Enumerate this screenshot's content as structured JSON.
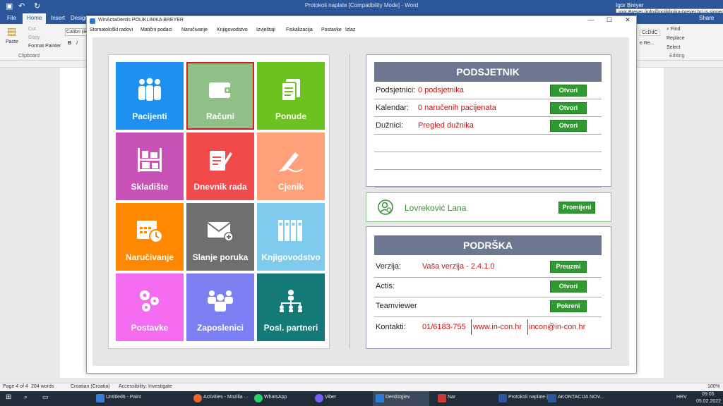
{
  "word": {
    "title": "Protokoli naplate [Compatibility Mode] - Word",
    "user": "Igor Breyer",
    "tooltip": "Igor Breyer (info@poliklinika-breyer.hr) is signed in",
    "tabs": [
      "File",
      "Home",
      "Insert",
      "Design"
    ],
    "share": "Share",
    "ribbon": {
      "cut": "Cut",
      "copy": "Copy",
      "paste": "Paste",
      "format_painter": "Format Painter",
      "clipboard": "Clipboard",
      "font": "Calibri (Bo",
      "find": "Find",
      "replace": "Replace",
      "select": "Select",
      "editing": "Editing",
      "style_code": "CcDdC",
      "style_re": "e Re..."
    },
    "status": {
      "page": "Page 4 of 4",
      "words": "204 words",
      "language": "Croatian (Croatia)",
      "accessibility": "Accessibility: Investigate",
      "zoom": "100%"
    }
  },
  "app": {
    "title": "WinActaDentis  POLIKLINIKA BREYER",
    "controls": {
      "minimize": "—",
      "maximize": "☐",
      "close": "✕"
    },
    "menu": [
      "Stomatološki radovi",
      "Matični podaci",
      "Naručivanje",
      "Knjigovodstvo",
      "Izvještaji",
      "Fiskalizacija",
      "Postavke",
      "Izlaz"
    ],
    "tiles": [
      {
        "label": "Pacijenti",
        "color": "#1e90f0",
        "icon": "people-icon"
      },
      {
        "label": "Računi",
        "color": "#8fc187",
        "icon": "wallet-icon"
      },
      {
        "label": "Ponude",
        "color": "#6cc21e",
        "icon": "documents-icon"
      },
      {
        "label": "Skladište",
        "color": "#c852b8",
        "icon": "shelves-icon"
      },
      {
        "label": "Dnevnik rada",
        "color": "#f04a4a",
        "icon": "edit-document-icon"
      },
      {
        "label": "Cjenik",
        "color": "#ffa07a",
        "icon": "pen-icon"
      },
      {
        "label": "Naručivanje",
        "color": "#ff8800",
        "icon": "calendar-clock-icon"
      },
      {
        "label": "Slanje poruka",
        "color": "#6f6f6f",
        "icon": "envelope-plus-icon"
      },
      {
        "label": "Knjigovodstvo",
        "color": "#7fcbee",
        "icon": "binders-icon"
      },
      {
        "label": "Postavke",
        "color": "#f46cf0",
        "icon": "gears-icon"
      },
      {
        "label": "Zaposlenici",
        "color": "#7b7ff2",
        "icon": "team-icon"
      },
      {
        "label": "Posl. partneri",
        "color": "#137a78",
        "icon": "hierarchy-icon"
      }
    ],
    "reminder": {
      "title": "PODSJETNIK",
      "rows": [
        {
          "key": "Podsjetnici:",
          "value": "0 podsjetnika",
          "button": "Otvori"
        },
        {
          "key": "Kalendar:",
          "value": "0 naručenih pacijenata",
          "button": "Otvori"
        },
        {
          "key": "Dužnici:",
          "value": "Pregled dužnika",
          "button": "Otvori"
        }
      ]
    },
    "user": {
      "name": "Lovreković Lana",
      "button": "Promijeni"
    },
    "support": {
      "title": "PODRŠKA",
      "version_key": "Verzija:",
      "version_value": "Vaša verzija - 2.4.1.0",
      "version_button": "Preuzmi",
      "actis_key": "Actis:",
      "actis_button": "Otvori",
      "teamviewer_key": "Teamviewer",
      "teamviewer_button": "Pokreni",
      "contacts_key": "Kontakti:",
      "phone": "01/6183-755",
      "web": "www.in-con.hr",
      "email": "incon@in-con.hr"
    }
  },
  "taskbar": {
    "items": [
      "Untitled6 - Paint",
      "Activities - Mozilla ...",
      "WhatsApp",
      "Viber",
      "Dentistgiev",
      "Nar",
      "Protokoli naplate |...",
      "AKONTACIJA NOV..."
    ],
    "lang": "HRV",
    "time": "09:05",
    "date": "05.02.2022"
  },
  "colors": {
    "accent": "#2b579a",
    "header": "#6d7790",
    "button": "#2f9a2f",
    "value": "#c81414",
    "user_text": "#3a8a3a"
  }
}
